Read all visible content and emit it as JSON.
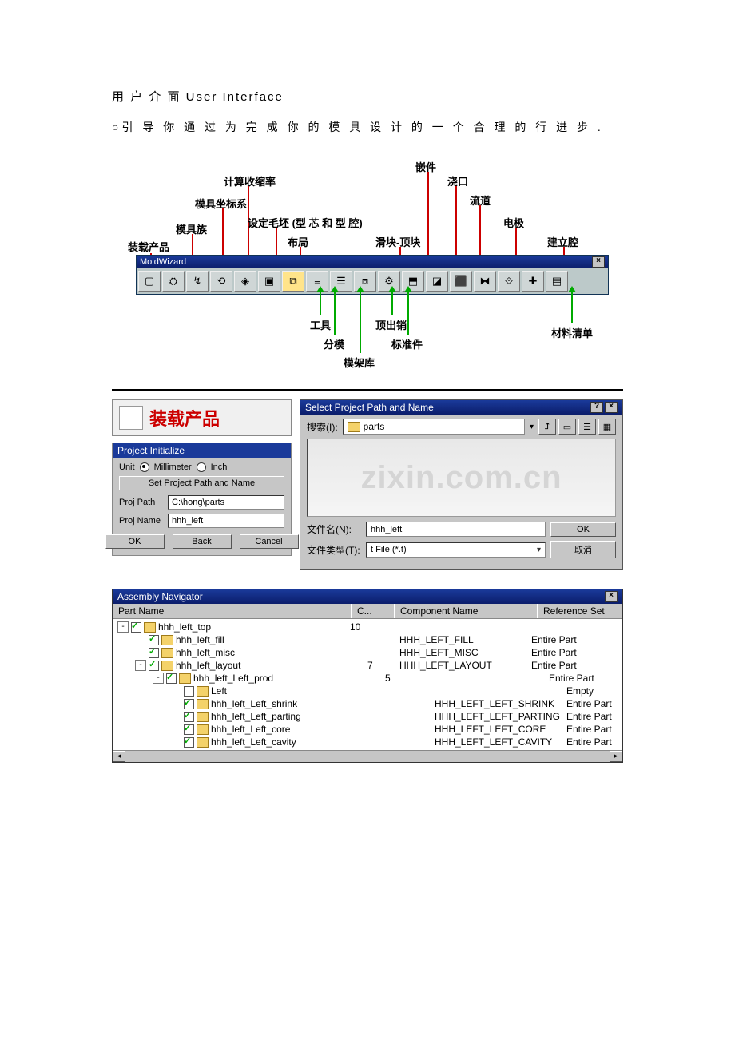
{
  "heading": "用 户 介 面 User Interface",
  "intro": "○引 导 你 通 过 为 完 成 你 的 模 具 设 计 的 一 个 合 理 的 行 进 步 .",
  "diagram": {
    "toolbar_title": "MoldWizard",
    "top_labels": {
      "load_product": "装载产品",
      "mold_family": "模具族",
      "csys": "模具坐标系",
      "shrinkage": "计算收缩率",
      "workpiece": "设定毛坯 (型 芯 和 型 腔)",
      "layout": "布局",
      "slider_lifter": "滑块-顶块",
      "inserts": "嵌件",
      "gate": "浇口",
      "runner": "流道",
      "electrode": "电极",
      "cavity": "建立腔"
    },
    "bottom_labels": {
      "tool": "工具",
      "parting": "分模",
      "moldbase": "模架库",
      "standard": "标准件",
      "ejector": "顶出销",
      "bom": "材料清单"
    }
  },
  "load_header": "装载产品",
  "project_init": {
    "title": "Project Initialize",
    "unit_label": "Unit",
    "unit_mm": "Millimeter",
    "unit_inch": "Inch",
    "set_path_btn": "Set Project Path and Name",
    "proj_path_label": "Proj Path",
    "proj_path_value": "C:\\hong\\parts",
    "proj_name_label": "Proj Name",
    "proj_name_value": "hhh_left",
    "ok": "OK",
    "back": "Back",
    "cancel": "Cancel"
  },
  "filedlg": {
    "title": "Select Project Path and Name",
    "search_label": "搜索(I):",
    "folder": "parts",
    "filename_label": "文件名(N):",
    "filename_value": "hhh_left",
    "filetype_label": "文件类型(T):",
    "filetype_value": "t File (*.t)",
    "ok": "OK",
    "cancel": "取消",
    "watermark": "zixin.com.cn"
  },
  "asm": {
    "title": "Assembly Navigator",
    "headers": {
      "part": "Part Name",
      "c": "C...",
      "comp": "Component Name",
      "ref": "Reference Set"
    },
    "rows": [
      {
        "indent": 0,
        "exp": "-",
        "chk": true,
        "name": "hhh_left_top",
        "c": "10",
        "comp": "",
        "ref": ""
      },
      {
        "indent": 1,
        "exp": "",
        "chk": true,
        "name": "hhh_left_fill",
        "c": "",
        "comp": "HHH_LEFT_FILL",
        "ref": "Entire Part"
      },
      {
        "indent": 1,
        "exp": "",
        "chk": true,
        "name": "hhh_left_misc",
        "c": "",
        "comp": "HHH_LEFT_MISC",
        "ref": "Entire Part"
      },
      {
        "indent": 1,
        "exp": "-",
        "chk": true,
        "name": "hhh_left_layout",
        "c": "7",
        "comp": "HHH_LEFT_LAYOUT",
        "ref": "Entire Part"
      },
      {
        "indent": 2,
        "exp": "-",
        "chk": true,
        "name": "hhh_left_Left_prod",
        "c": "5",
        "comp": "",
        "ref": "Entire Part"
      },
      {
        "indent": 3,
        "exp": "",
        "chk": false,
        "name": "Left",
        "c": "",
        "comp": "",
        "ref": "Empty"
      },
      {
        "indent": 3,
        "exp": "",
        "chk": true,
        "name": "hhh_left_Left_shrink",
        "c": "",
        "comp": "HHH_LEFT_LEFT_SHRINK",
        "ref": "Entire Part"
      },
      {
        "indent": 3,
        "exp": "",
        "chk": true,
        "name": "hhh_left_Left_parting",
        "c": "",
        "comp": "HHH_LEFT_LEFT_PARTING",
        "ref": "Entire Part"
      },
      {
        "indent": 3,
        "exp": "",
        "chk": true,
        "name": "hhh_left_Left_core",
        "c": "",
        "comp": "HHH_LEFT_LEFT_CORE",
        "ref": "Entire Part"
      },
      {
        "indent": 3,
        "exp": "",
        "chk": true,
        "name": "hhh_left_Left_cavity",
        "c": "",
        "comp": "HHH_LEFT_LEFT_CAVITY",
        "ref": "Entire Part"
      }
    ]
  }
}
